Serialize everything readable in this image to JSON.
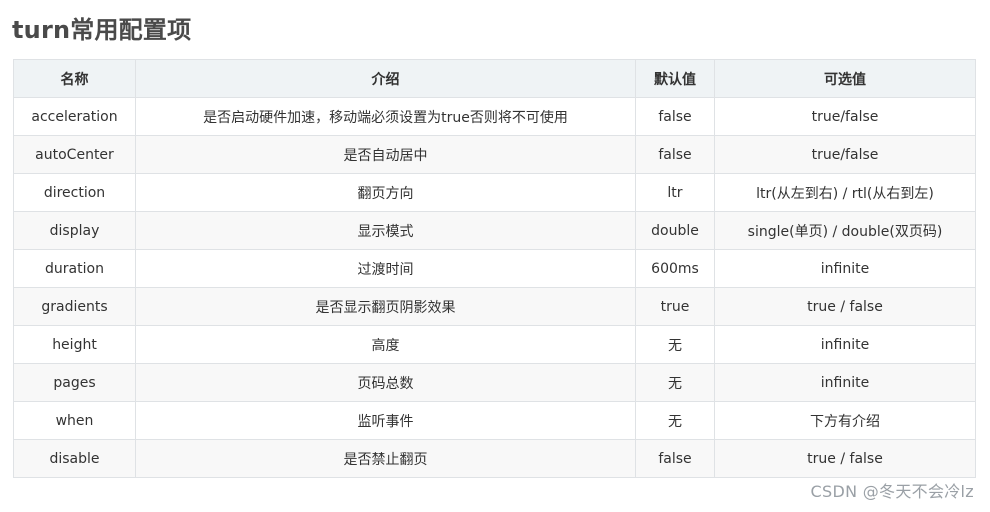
{
  "title": "turn常用配置项",
  "table": {
    "headers": [
      "名称",
      "介绍",
      "默认值",
      "可选值"
    ],
    "rows": [
      [
        "acceleration",
        "是否启动硬件加速，移动端必须设置为true否则将不可使用",
        "false",
        "true/false"
      ],
      [
        "autoCenter",
        "是否自动居中",
        "false",
        "true/false"
      ],
      [
        "direction",
        "翻页方向",
        "ltr",
        "ltr(从左到右) / rtl(从右到左)"
      ],
      [
        "display",
        "显示模式",
        "double",
        "single(单页) / double(双页码)"
      ],
      [
        "duration",
        "过渡时间",
        "600ms",
        "infinite"
      ],
      [
        "gradients",
        "是否显示翻页阴影效果",
        "true",
        "true / false"
      ],
      [
        "height",
        "高度",
        "无",
        "infinite"
      ],
      [
        "pages",
        "页码总数",
        "无",
        "infinite"
      ],
      [
        "when",
        "监听事件",
        "无",
        "下方有介绍"
      ],
      [
        "disable",
        "是否禁止翻页",
        "false",
        "true / false"
      ]
    ]
  },
  "watermark": "CSDN @冬天不会冷lz"
}
